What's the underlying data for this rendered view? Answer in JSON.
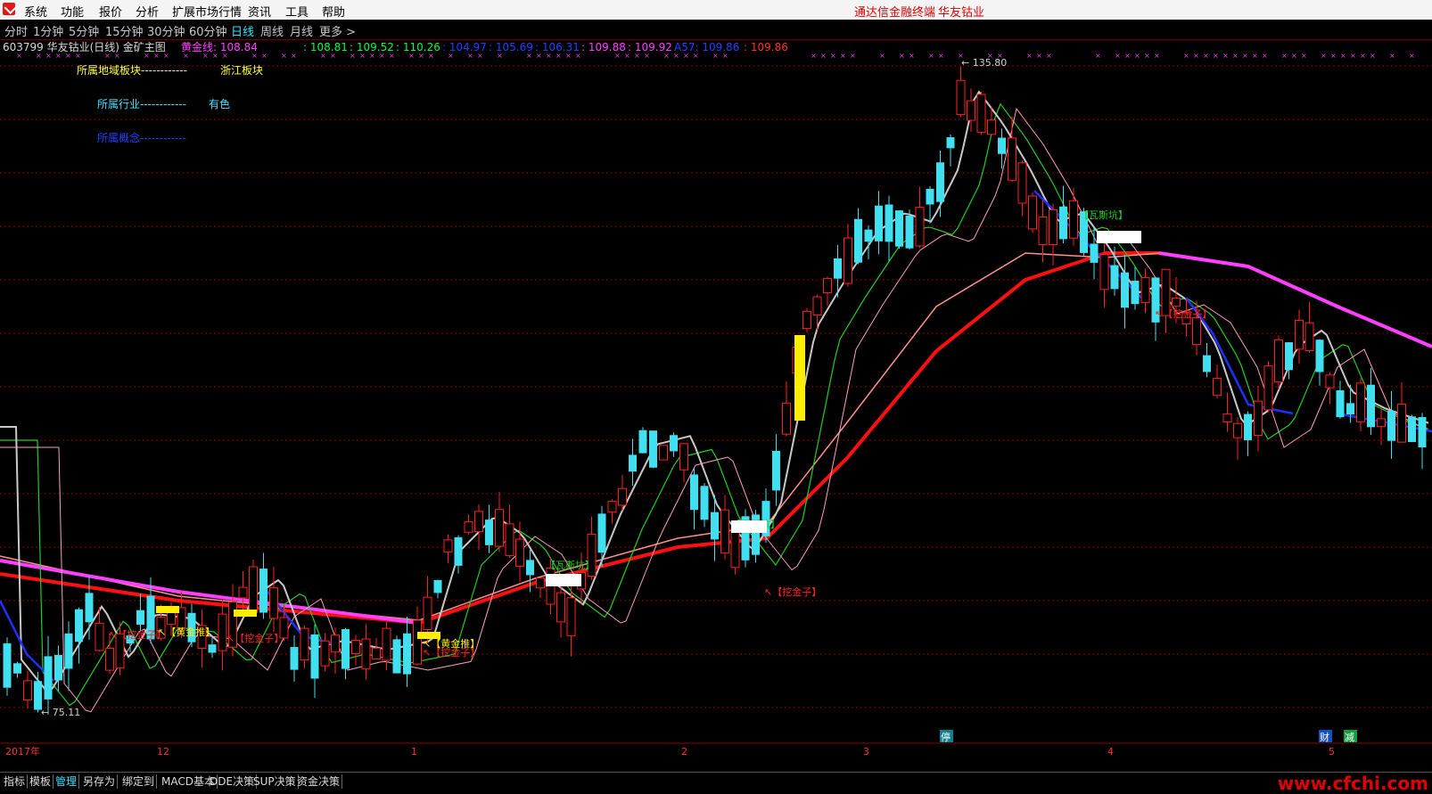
{
  "menubar": {
    "items": [
      "系统",
      "功能",
      "报价",
      "分析",
      "扩展市场行情",
      "资讯",
      "工具",
      "帮助"
    ],
    "brand_left": "通达信金融终端",
    "brand_right": "华友钴业"
  },
  "periods": {
    "items": [
      "分时",
      "1分钟",
      "5分钟",
      "15分钟",
      "30分钟",
      "60分钟",
      "日线",
      "周线",
      "月线",
      "更多 >"
    ],
    "active": "日线"
  },
  "chart_header": {
    "title": "603799 华友钴业(日线) 金矿主图",
    "gold_label": "黄金线: 108.84",
    "values": [
      {
        "text": ": 108.81",
        "color": "#00ff40"
      },
      {
        "text": ": 109.52",
        "color": "#00ff40"
      },
      {
        "text": ": 110.26",
        "color": "#00ff40"
      },
      {
        "text": ": 104.97",
        "color": "#2040ff"
      },
      {
        "text": ": 105.69",
        "color": "#2040ff"
      },
      {
        "text": ": 106.31",
        "color": "#2040ff"
      },
      {
        "text": ": 109.88",
        "color": "#ff40ff"
      },
      {
        "text": ": 109.92",
        "color": "#ff40ff"
      },
      {
        "text": "A57: 109.86",
        "color": "#2040ff"
      },
      {
        "text": ": 109.86",
        "color": "#ff3030"
      }
    ]
  },
  "info": {
    "region_label": "所属地域板块------------",
    "region_value": "浙江板块",
    "industry_label": "所属行业------------",
    "industry_value": "有色",
    "concept_label": "所属概念------------"
  },
  "chart_data": {
    "type": "candlestick",
    "stock": "603799 华友钴业",
    "period": "日线",
    "high_label": "135.80",
    "low_label": "75.11",
    "x_tick_labels": [
      "2017年",
      "12",
      "1",
      "2",
      "3",
      "4",
      "5"
    ],
    "signal_labels": {
      "dig_gold": "【挖金子】",
      "gold_push": "【黄金推】",
      "gas_pit": "【瓦斯坑】"
    },
    "bottom_markers": [
      "停",
      "财",
      "减"
    ],
    "colors": {
      "up": "#ff2020",
      "down": "#40e0f0",
      "ma_red": "#ff1010",
      "ma_magenta": "#ff40ff",
      "ma_green": "#20d020",
      "ma_blue": "#2030ff",
      "grid": "#8b0000"
    }
  },
  "bottom_tabs": {
    "items": [
      "指标",
      "模板",
      "管理",
      "另存为",
      "绑定到",
      "MACD基本",
      "DDE决策",
      "SUP决策",
      "资金决策"
    ],
    "active": "管理"
  },
  "watermark": "www.cfchi.com"
}
